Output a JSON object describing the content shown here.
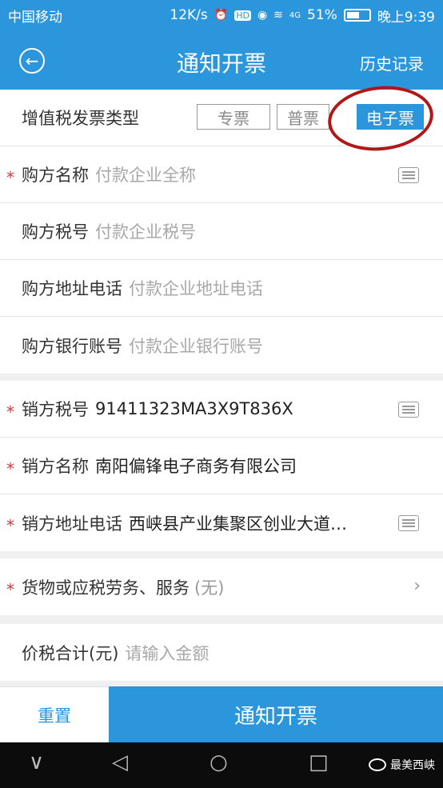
{
  "status": {
    "carrier": "中国移动",
    "speed": "12K/s",
    "hd": "HD",
    "signal": "4G",
    "battery": "51%",
    "time": "晚上9:39"
  },
  "nav": {
    "title": "通知开票",
    "history": "历史记录"
  },
  "invoice_type": {
    "label": "增值税发票类型",
    "options": [
      "专票",
      "普票",
      "电子票"
    ],
    "selected": "电子票"
  },
  "buyer": {
    "name_label": "购方名称",
    "name_placeholder": "付款企业全称",
    "tax_label": "购方税号",
    "tax_placeholder": "付款企业税号",
    "address_label": "购方地址电话",
    "address_placeholder": "付款企业地址电话",
    "bank_label": "购方银行账号",
    "bank_placeholder": "付款企业银行账号"
  },
  "seller": {
    "tax_label": "销方税号",
    "tax_value": "91411323MA3X9T836X",
    "name_label": "销方名称",
    "name_value": "南阳偏锋电子商务有限公司",
    "address_label": "销方地址电话",
    "address_value": "西峡县产业集聚区创业大道…"
  },
  "goods": {
    "label": "货物或应税劳务、服务",
    "value": "(无)"
  },
  "amount": {
    "label": "价税合计(元)",
    "placeholder": "请输入金额"
  },
  "buttons": {
    "reset": "重置",
    "submit": "通知开票"
  },
  "sysnav": {
    "down": "∨",
    "back": "◁",
    "home": "○",
    "recent": "□"
  },
  "watermark": "最美西峡",
  "required_mark": "*",
  "chevron": "›",
  "colors": {
    "primary": "#2b96dc",
    "required": "#d23a3a",
    "annotation": "#b01818"
  }
}
